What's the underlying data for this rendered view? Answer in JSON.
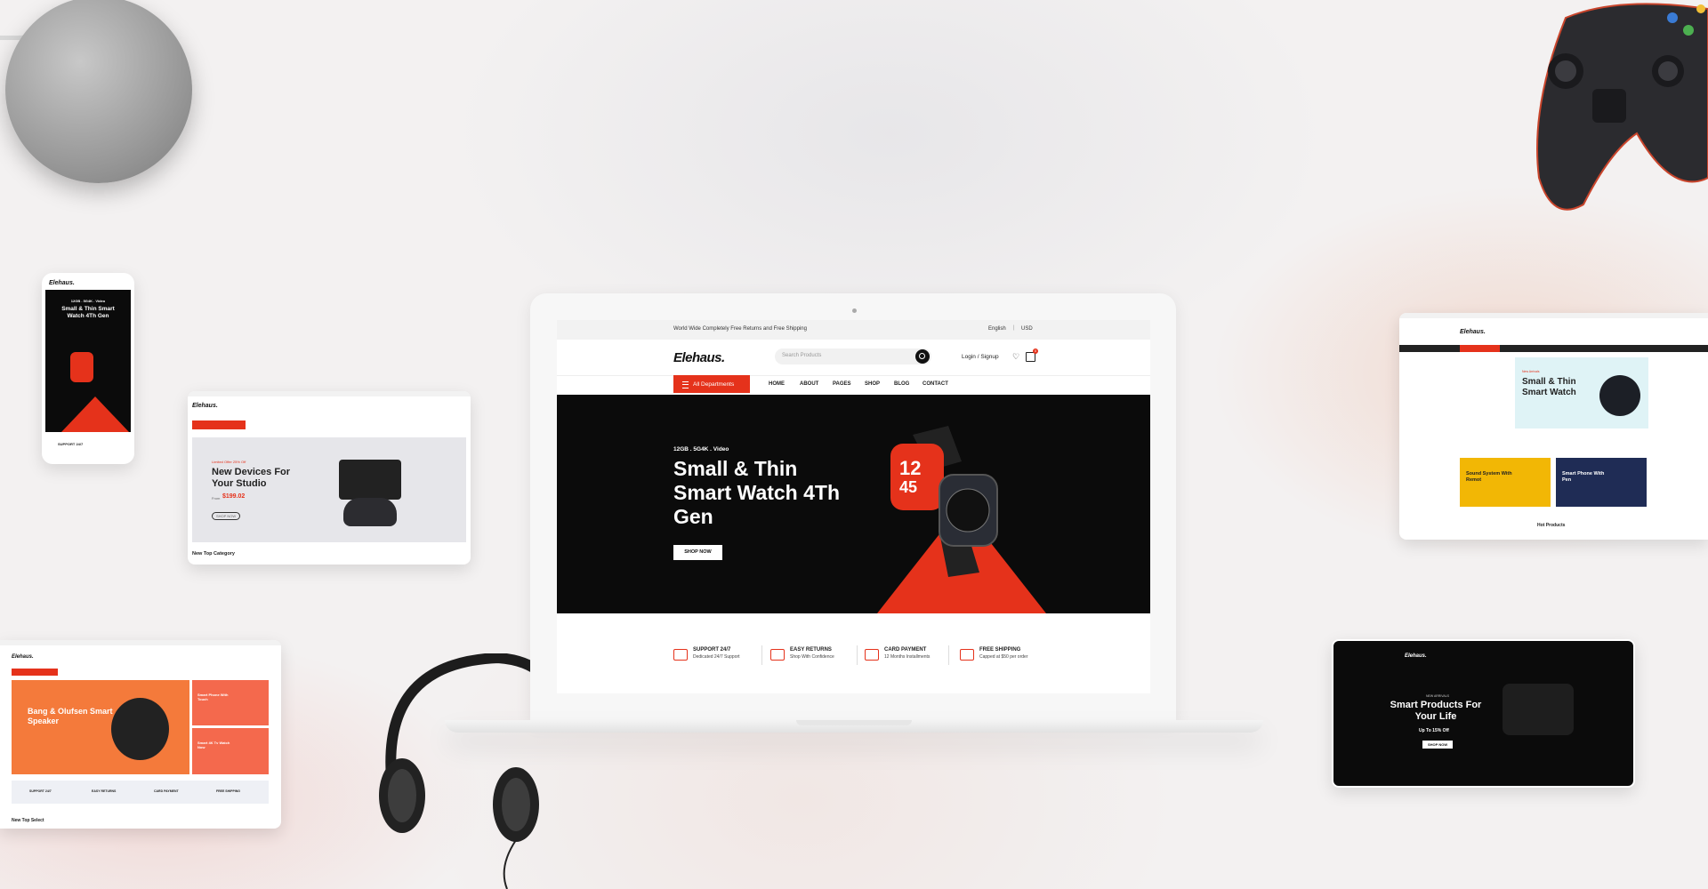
{
  "store": {
    "brand": "Elehaus.",
    "promo": "World Wide Completely Free Returns and Free Shipping",
    "language": "English",
    "currency": "USD",
    "search_placeholder": "Search Products",
    "login": "Login / Signup",
    "cart_count": "0",
    "departments": "All Departments",
    "menu": [
      "HOME",
      "ABOUT",
      "PAGES",
      "SHOP",
      "BLOG",
      "CONTACT"
    ]
  },
  "hero": {
    "tag": "12GB . 5G4K . Video",
    "title": "Small & Thin Smart Watch 4Th Gen",
    "button": "SHOP NOW"
  },
  "features": [
    {
      "title": "SUPPORT 24/7",
      "sub": "Dedicated 24/7 Support"
    },
    {
      "title": "EASY RETURNS",
      "sub": "Shop With Confidence"
    },
    {
      "title": "CARD PAYMENT",
      "sub": "12 Months Installments"
    },
    {
      "title": "FREE SHIPPING",
      "sub": "Capped at $50 per order"
    }
  ],
  "phone": {
    "tag": "12GB . 5G4K . Video",
    "title": "Small & Thin Smart Watch 4Th Gen",
    "support": "SUPPORT 24/7"
  },
  "tablet_left": {
    "kicker": "Limited Offer 25% Off",
    "title": "New Devices For Your Studio",
    "price_label": "From",
    "price": "$199.02",
    "button": "SHOP NOW",
    "section": "New Top Category"
  },
  "tablet_right": {
    "kicker": "New Arrivals",
    "title": "Small & Thin Smart Watch",
    "card1": "Sound System With Remot",
    "card2": "Smart Phone With Pen",
    "section": "Hot Products"
  },
  "laptop_left": {
    "title": "Bang & Olufsen Smart Speaker",
    "side1": "Smart Phone With Touch",
    "side2": "Smart 4K Tv Watch Now",
    "section": "New Top Select",
    "features": [
      "SUPPORT 24/7",
      "EASY RETURNS",
      "CARD PAYMENT",
      "FREE SHIPPING"
    ]
  },
  "dark_screen": {
    "kicker": "NEW ARRIVALS",
    "title": "Smart Products For Your Life",
    "offer": "Up To 15% Off",
    "button": "SHOP NOW"
  },
  "colors": {
    "accent": "#e5321b",
    "dark": "#0b0b0b"
  }
}
